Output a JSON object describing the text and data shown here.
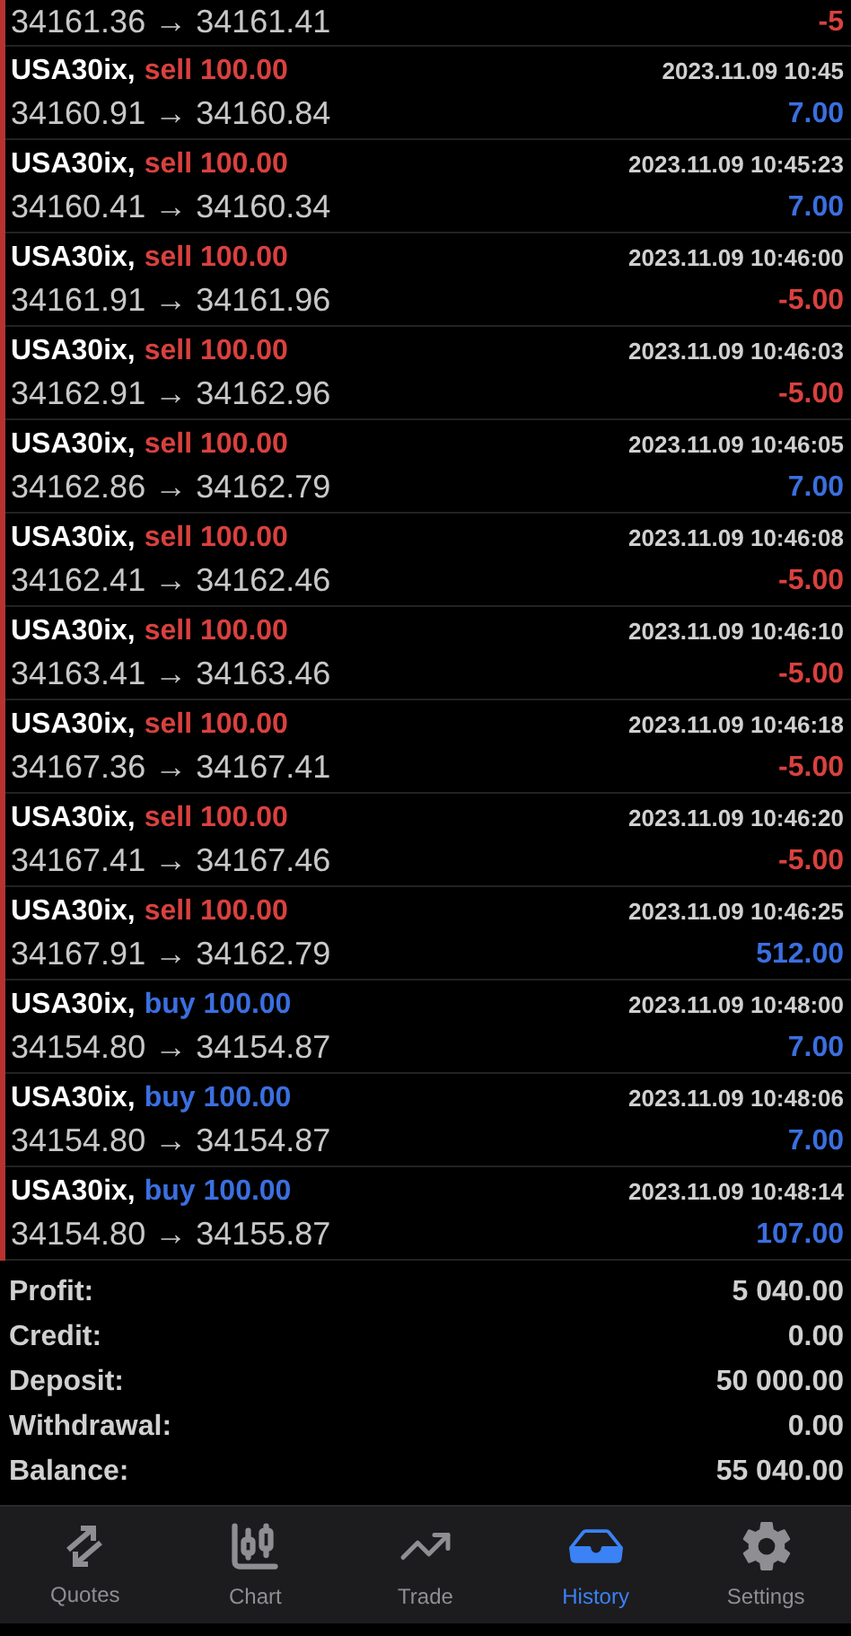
{
  "top_row": {
    "prices": "34161.36 → 34161.41",
    "profit": "-5",
    "color": "#d9413f"
  },
  "rows": [
    {
      "symbol": "USA30ix,",
      "kind": "sell",
      "volume": "sell 100.00",
      "time": "2023.11.09 10:45",
      "prices": "34160.91 → 34160.84",
      "profit": "7.00",
      "color": "#3b6fe0"
    },
    {
      "symbol": "USA30ix,",
      "kind": "sell",
      "volume": "sell 100.00",
      "time": "2023.11.09 10:45:23",
      "prices": "34160.41 → 34160.34",
      "profit": "7.00",
      "color": "#3b6fe0"
    },
    {
      "symbol": "USA30ix,",
      "kind": "sell",
      "volume": "sell 100.00",
      "time": "2023.11.09 10:46:00",
      "prices": "34161.91 → 34161.96",
      "profit": "-5.00",
      "color": "#d9413f"
    },
    {
      "symbol": "USA30ix,",
      "kind": "sell",
      "volume": "sell 100.00",
      "time": "2023.11.09 10:46:03",
      "prices": "34162.91 → 34162.96",
      "profit": "-5.00",
      "color": "#d9413f"
    },
    {
      "symbol": "USA30ix,",
      "kind": "sell",
      "volume": "sell 100.00",
      "time": "2023.11.09 10:46:05",
      "prices": "34162.86 → 34162.79",
      "profit": "7.00",
      "color": "#3b6fe0"
    },
    {
      "symbol": "USA30ix,",
      "kind": "sell",
      "volume": "sell 100.00",
      "time": "2023.11.09 10:46:08",
      "prices": "34162.41 → 34162.46",
      "profit": "-5.00",
      "color": "#d9413f"
    },
    {
      "symbol": "USA30ix,",
      "kind": "sell",
      "volume": "sell 100.00",
      "time": "2023.11.09 10:46:10",
      "prices": "34163.41 → 34163.46",
      "profit": "-5.00",
      "color": "#d9413f"
    },
    {
      "symbol": "USA30ix,",
      "kind": "sell",
      "volume": "sell 100.00",
      "time": "2023.11.09 10:46:18",
      "prices": "34167.36 → 34167.41",
      "profit": "-5.00",
      "color": "#d9413f"
    },
    {
      "symbol": "USA30ix,",
      "kind": "sell",
      "volume": "sell 100.00",
      "time": "2023.11.09 10:46:20",
      "prices": "34167.41 → 34167.46",
      "profit": "-5.00",
      "color": "#d9413f"
    },
    {
      "symbol": "USA30ix,",
      "kind": "sell",
      "volume": "sell 100.00",
      "time": "2023.11.09 10:46:25",
      "prices": "34167.91 → 34162.79",
      "profit": "512.00",
      "color": "#3b6fe0"
    },
    {
      "symbol": "USA30ix,",
      "kind": "buy",
      "volume": "buy 100.00",
      "time": "2023.11.09 10:48:00",
      "prices": "34154.80 → 34154.87",
      "profit": "7.00",
      "color": "#3b6fe0"
    },
    {
      "symbol": "USA30ix,",
      "kind": "buy",
      "volume": "buy 100.00",
      "time": "2023.11.09 10:48:06",
      "prices": "34154.80 → 34154.87",
      "profit": "7.00",
      "color": "#3b6fe0"
    },
    {
      "symbol": "USA30ix,",
      "kind": "buy",
      "volume": "buy 100.00",
      "time": "2023.11.09 10:48:14",
      "prices": "34154.80 → 34155.87",
      "profit": "107.00",
      "color": "#3b6fe0"
    }
  ],
  "summary": [
    {
      "label": "Profit:",
      "value": "5 040.00"
    },
    {
      "label": "Credit:",
      "value": "0.00"
    },
    {
      "label": "Deposit:",
      "value": "50 000.00"
    },
    {
      "label": "Withdrawal:",
      "value": "0.00"
    },
    {
      "label": "Balance:",
      "value": "55 040.00"
    }
  ],
  "tabs": [
    {
      "label": "Quotes",
      "kind": "quotes",
      "selected": false
    },
    {
      "label": "Chart",
      "kind": "chart",
      "selected": false
    },
    {
      "label": "Trade",
      "kind": "trade",
      "selected": false
    },
    {
      "label": "History",
      "kind": "history",
      "selected": true
    },
    {
      "label": "Settings",
      "kind": "settings",
      "selected": false
    }
  ]
}
